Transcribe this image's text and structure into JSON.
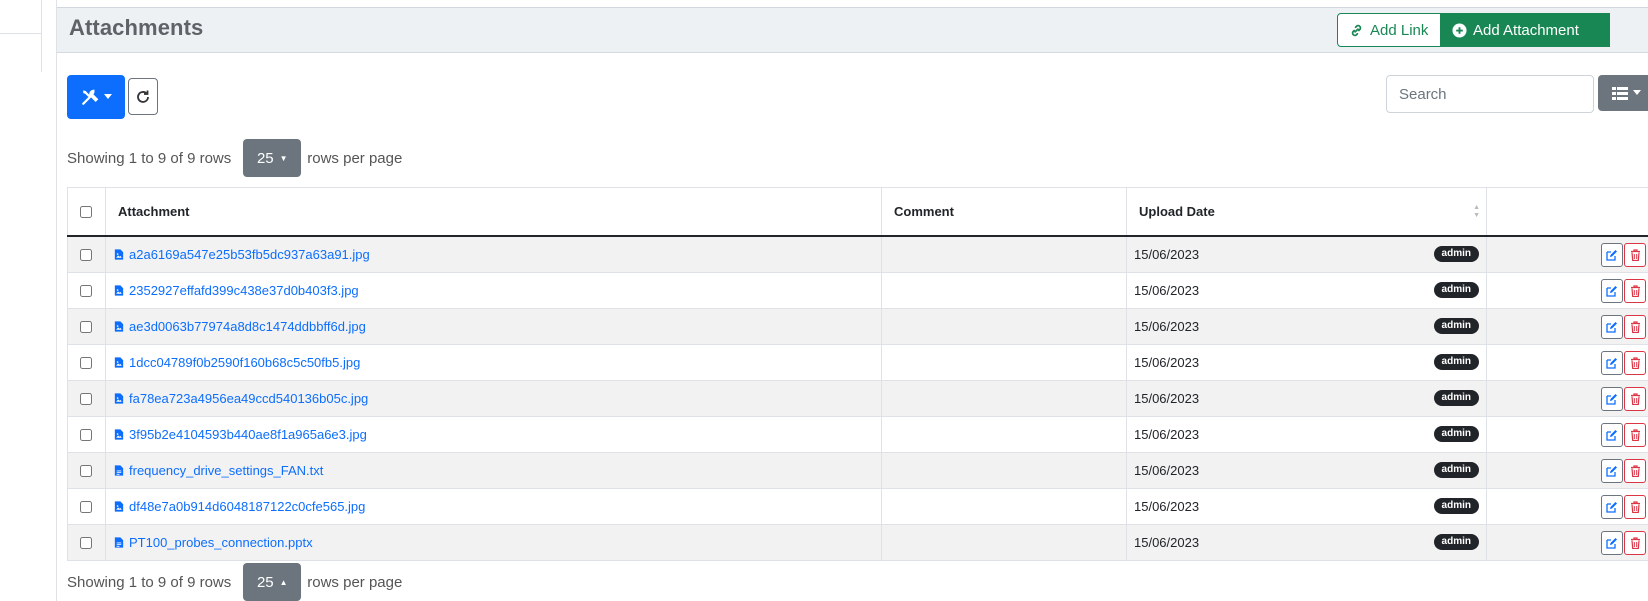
{
  "panel": {
    "title": "Attachments"
  },
  "header_buttons": {
    "add_link": "Add Link",
    "add_attachment": "Add Attachment"
  },
  "toolbar": {
    "search_placeholder": "Search"
  },
  "pagination": {
    "showing": "Showing 1 to 9 of 9 rows",
    "page_size": "25",
    "rows_per_page": "rows per page"
  },
  "table": {
    "columns": [
      "Attachment",
      "Comment",
      "Upload Date"
    ],
    "rows": [
      {
        "file": "a2a6169a547e25b53fb5dc937a63a91.jpg",
        "type": "image",
        "comment": "",
        "date": "15/06/2023",
        "user": "admin"
      },
      {
        "file": "2352927effafd399c438e37d0b403f3.jpg",
        "type": "image",
        "comment": "",
        "date": "15/06/2023",
        "user": "admin"
      },
      {
        "file": "ae3d0063b77974a8d8c1474ddbbff6d.jpg",
        "type": "image",
        "comment": "",
        "date": "15/06/2023",
        "user": "admin"
      },
      {
        "file": "1dcc04789f0b2590f160b68c5c50fb5.jpg",
        "type": "image",
        "comment": "",
        "date": "15/06/2023",
        "user": "admin"
      },
      {
        "file": "fa78ea723a4956ea49ccd540136b05c.jpg",
        "type": "image",
        "comment": "",
        "date": "15/06/2023",
        "user": "admin"
      },
      {
        "file": "3f95b2e4104593b440ae8f1a965a6e3.jpg",
        "type": "image",
        "comment": "",
        "date": "15/06/2023",
        "user": "admin"
      },
      {
        "file": "frequency_drive_settings_FAN.txt",
        "type": "text",
        "comment": "",
        "date": "15/06/2023",
        "user": "admin"
      },
      {
        "file": "df48e7a0b914d6048187122c0cfe565.jpg",
        "type": "image",
        "comment": "",
        "date": "15/06/2023",
        "user": "admin"
      },
      {
        "file": "PT100_probes_connection.pptx",
        "type": "document",
        "comment": "",
        "date": "15/06/2023",
        "user": "admin"
      }
    ]
  },
  "icons": {
    "tools": "wrench-screwdriver-icon",
    "refresh": "refresh-icon",
    "columns": "list-icon",
    "link": "link-icon",
    "add": "plus-circle-icon",
    "edit": "edit-icon",
    "delete": "trash-icon",
    "image_file": "file-image-icon",
    "text_file": "file-text-icon"
  },
  "colors": {
    "primary": "#0d6efd",
    "success": "#198754",
    "secondary": "#6c757d",
    "danger": "#dc3545",
    "dark": "#212529"
  }
}
